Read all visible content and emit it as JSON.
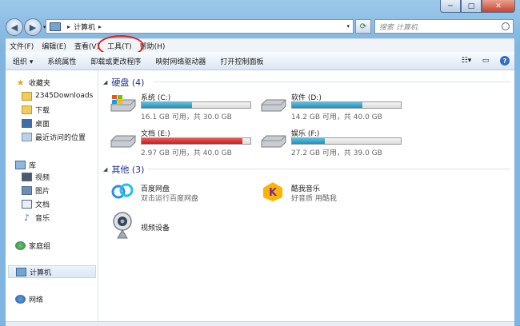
{
  "window": {
    "min_glyph": "─",
    "max_glyph": "□",
    "close_glyph": "✕"
  },
  "address": {
    "crumb": "计算机",
    "separator": "▸"
  },
  "search": {
    "placeholder": "搜索 计算机"
  },
  "menu": [
    "文件(F)",
    "编辑(E)",
    "查看(V)",
    "工具(T)",
    "帮助(H)"
  ],
  "toolbar": [
    "组织 ▾",
    "系统属性",
    "卸载或更改程序",
    "映射网络驱动器",
    "打开控制面板"
  ],
  "nav": {
    "favorites": "收藏夹",
    "fav_items": [
      "2345Downloads",
      "下载",
      "桌面",
      "最近访问的位置"
    ],
    "libraries": "库",
    "lib_items": [
      "视频",
      "图片",
      "文档",
      "音乐"
    ],
    "homegroup": "家庭组",
    "computer": "计算机",
    "network": "网络"
  },
  "sections": {
    "drives": "硬盘 (4)",
    "others": "其他 (3)"
  },
  "drives": [
    {
      "name": "系统 (C:)",
      "info": "16.1 GB 可用，共 30.0 GB",
      "used": 0.46,
      "critical": false
    },
    {
      "name": "软件 (D:)",
      "info": "14.2 GB 可用，共 40.0 GB",
      "used": 0.645,
      "critical": false
    },
    {
      "name": "文档 (E:)",
      "info": "2.97 GB 可用，共 40.0 GB",
      "used": 0.926,
      "critical": true
    },
    {
      "name": "娱乐 (F:)",
      "info": "27.2 GB 可用，共 39.0 GB",
      "used": 0.3,
      "critical": false
    }
  ],
  "others": [
    {
      "name": "百度网盘",
      "sub": "双击运行百度网盘",
      "icon": "baidu-netdisk-icon"
    },
    {
      "name": "酷我音乐",
      "sub": "好音质 用酷我",
      "icon": "kuwo-music-icon"
    },
    {
      "name": "视频设备",
      "sub": "",
      "icon": "webcam-icon"
    }
  ],
  "colors": {
    "drive_fill": "#1f8fb8",
    "drive_critical": "#c91a1a",
    "highlight_circle": "#e3211c"
  }
}
